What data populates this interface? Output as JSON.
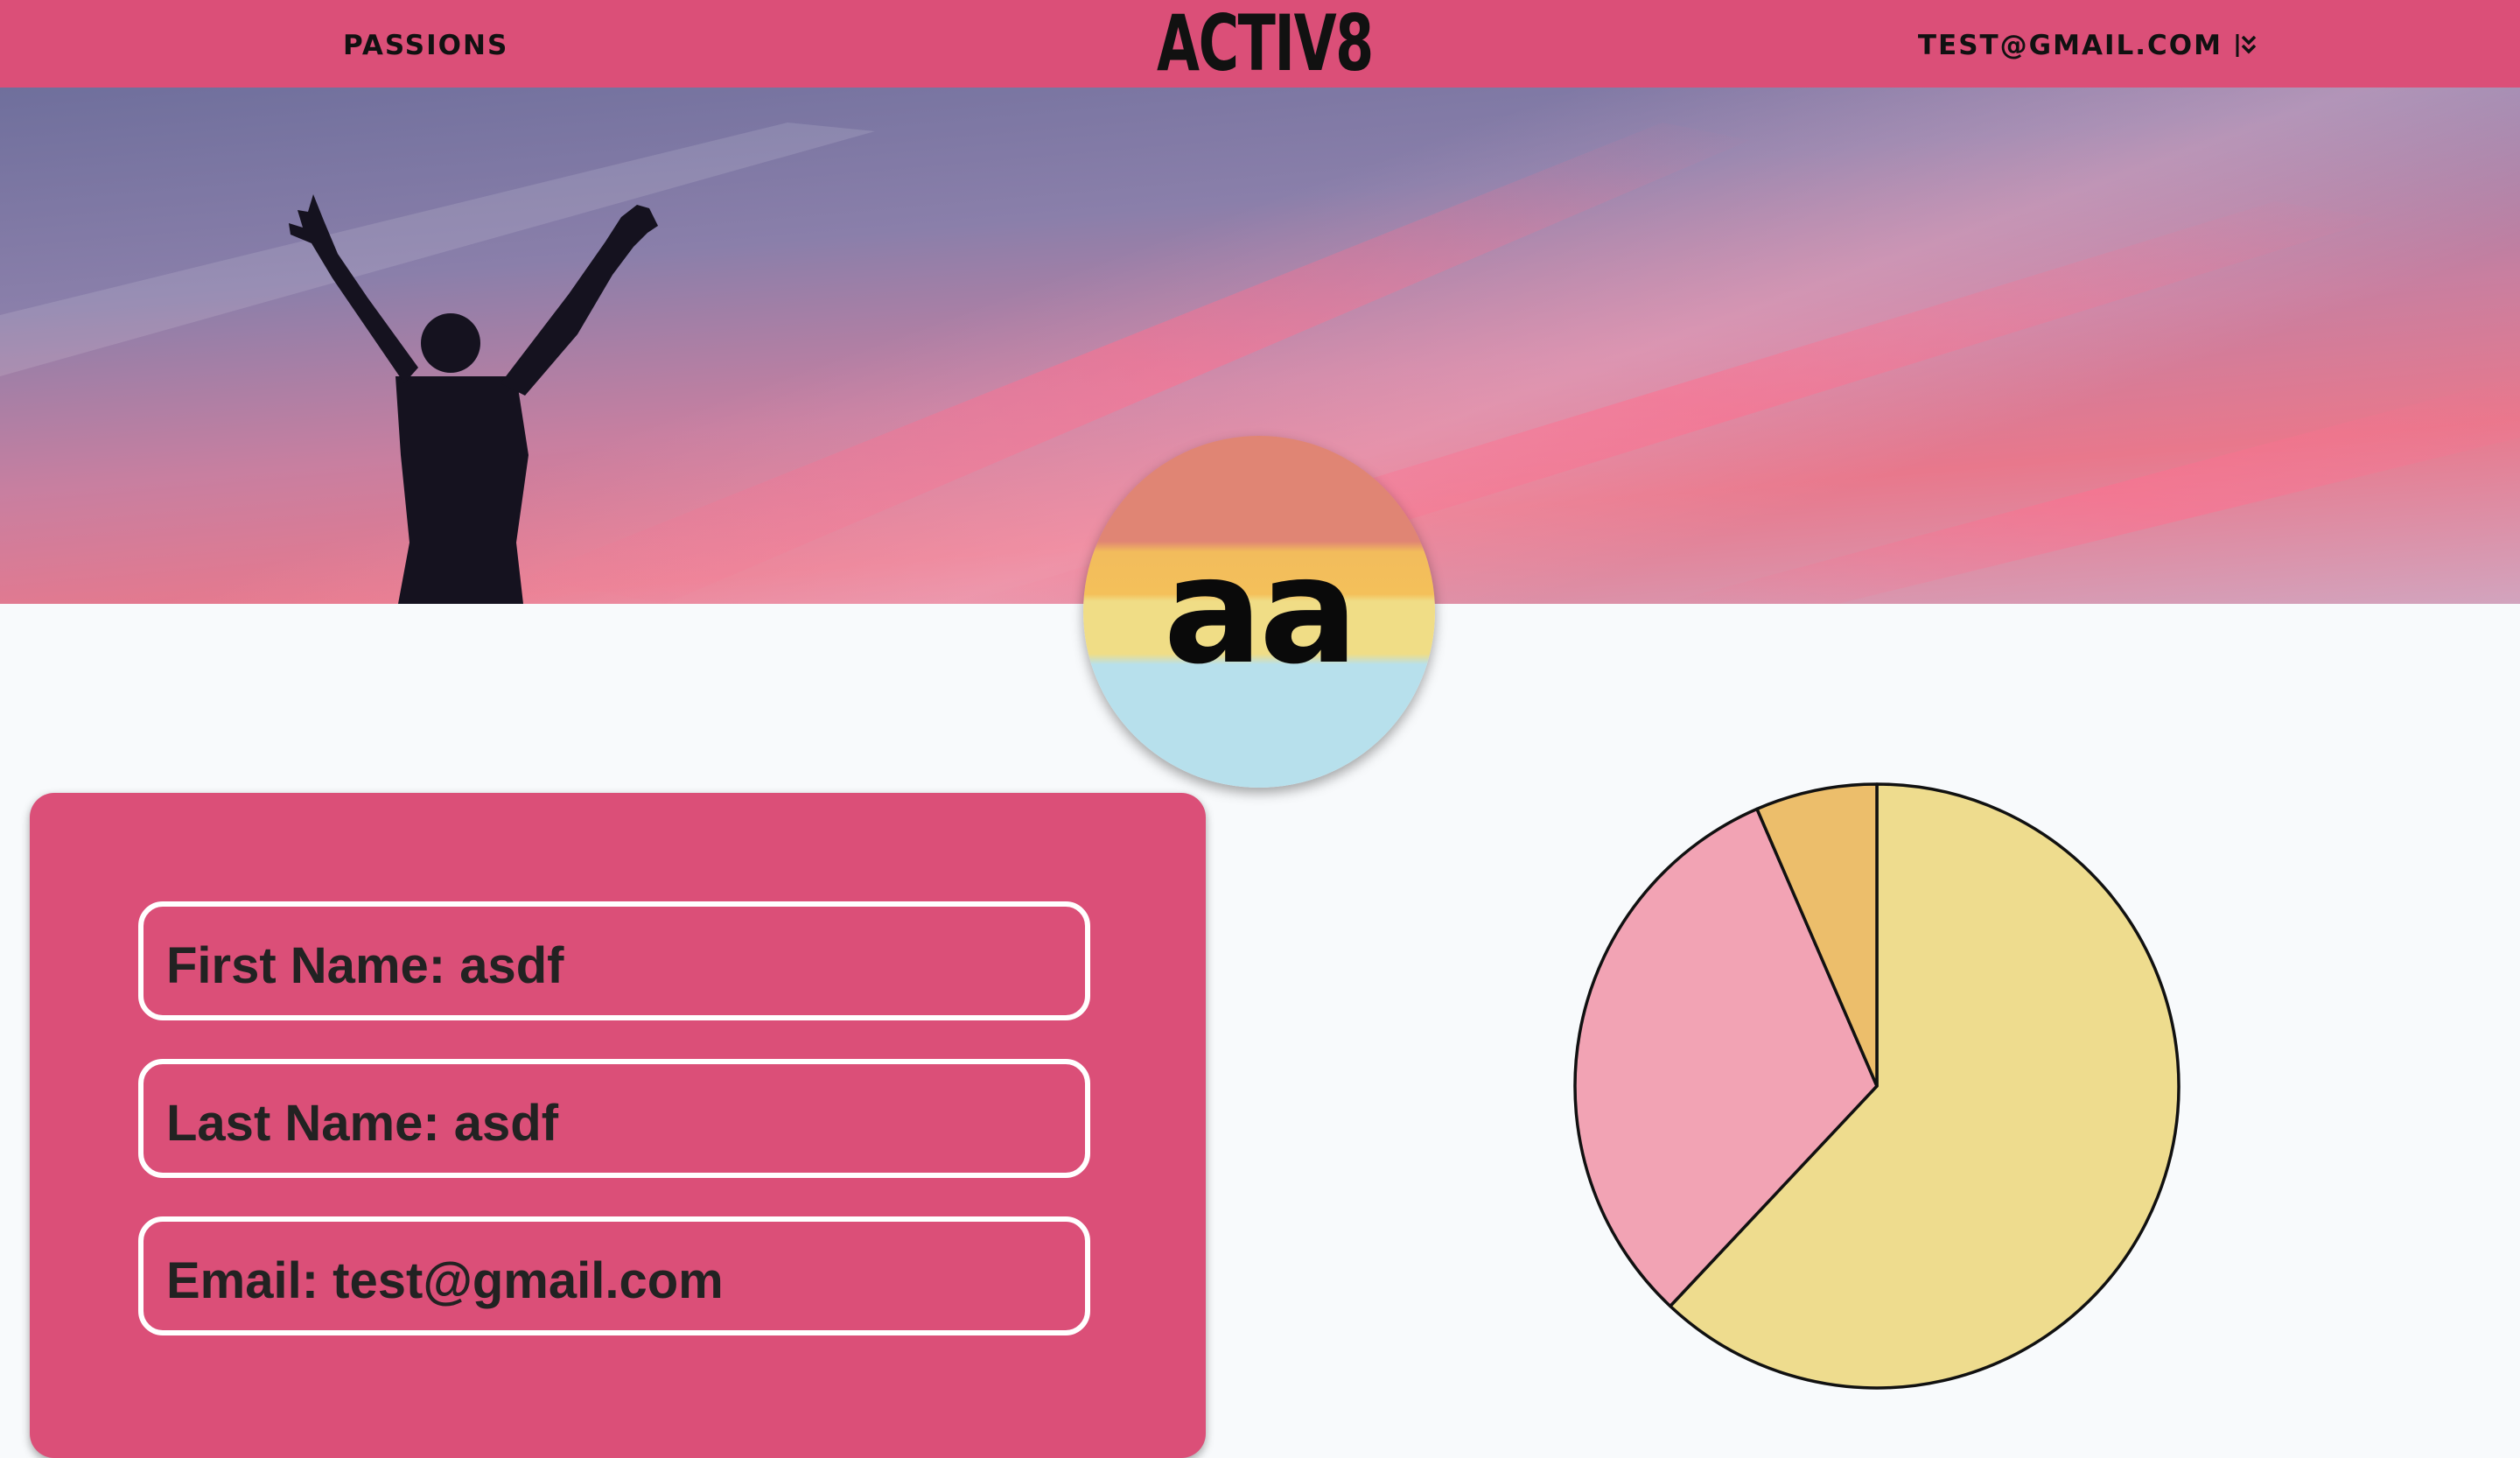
{
  "nav": {
    "passions_label": "PASSIONS",
    "logo_text": "ACTIV8",
    "user_email": "TEST@GMAIL.COM",
    "menu_icon": "double-chevron-down-icon"
  },
  "profile": {
    "initials": "aa",
    "fields": [
      {
        "label": "First Name: asdf"
      },
      {
        "label": "Last Name: asdf"
      },
      {
        "label": "Email: test@gmail.com"
      }
    ]
  },
  "colors": {
    "brand": "#db4f78",
    "slice_yellow": "#eedc8e",
    "slice_pink": "#f2a3b4",
    "slice_orange": "#ecbe6b"
  },
  "chart_data": {
    "type": "pie",
    "slices": [
      {
        "value": 62,
        "color": "#eedc8e"
      },
      {
        "value": 31.5,
        "color": "#f2a3b4"
      },
      {
        "value": 6.5,
        "color": "#ecbe6b"
      }
    ]
  }
}
